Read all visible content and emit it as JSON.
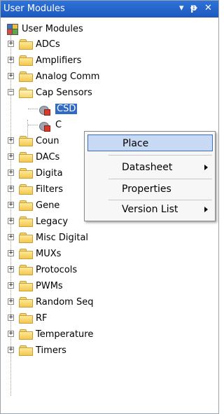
{
  "window": {
    "title": "User Modules",
    "pin_glyph": "▾ ⊥",
    "close_glyph": "✕"
  },
  "tree": {
    "root": "User Modules",
    "items": [
      {
        "label": "ADCs",
        "expanded": false
      },
      {
        "label": "Amplifiers",
        "expanded": false
      },
      {
        "label": "Analog Comm",
        "expanded": false
      },
      {
        "label": "Cap Sensors",
        "expanded": true
      },
      {
        "label": "CSD",
        "child": true,
        "selected": true
      },
      {
        "label": "C",
        "child": true
      },
      {
        "label": "Coun",
        "expanded": false
      },
      {
        "label": "DACs",
        "expanded": false
      },
      {
        "label": "Digita",
        "expanded": false
      },
      {
        "label": "Filters",
        "expanded": false
      },
      {
        "label": "Gene",
        "expanded": false
      },
      {
        "label": "Legacy",
        "expanded": false
      },
      {
        "label": "Misc Digital",
        "expanded": false
      },
      {
        "label": "MUXs",
        "expanded": false
      },
      {
        "label": "Protocols",
        "expanded": false
      },
      {
        "label": "PWMs",
        "expanded": false
      },
      {
        "label": "Random Seq",
        "expanded": false
      },
      {
        "label": "RF",
        "expanded": false
      },
      {
        "label": "Temperature",
        "expanded": false
      },
      {
        "label": "Timers",
        "expanded": false
      }
    ]
  },
  "context_menu": {
    "items": [
      {
        "label": "Place",
        "underline": "P",
        "highlighted": true
      },
      {
        "label": "Datasheet",
        "underline": "D",
        "submenu": true
      },
      {
        "label": "Properties",
        "underline": "P"
      },
      {
        "label": "Version List",
        "underline": "V",
        "submenu": true
      }
    ]
  }
}
